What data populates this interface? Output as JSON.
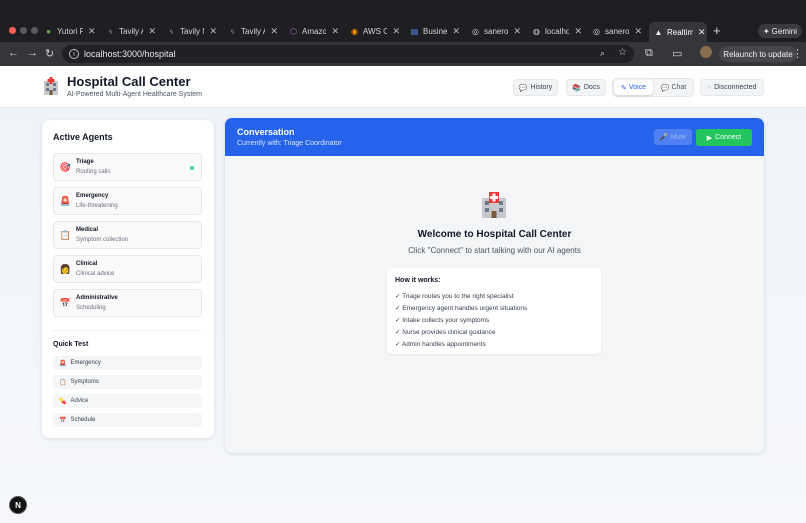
{
  "browser": {
    "tabs": [
      {
        "label": "Yutori Pl",
        "icon": "●"
      },
      {
        "label": "Tavily A",
        "icon": "ᛃ"
      },
      {
        "label": "Tavily M",
        "icon": "ᛃ"
      },
      {
        "label": "Tavily A",
        "icon": "ᛃ"
      },
      {
        "label": "Amazon",
        "icon": "⬡"
      },
      {
        "label": "AWS Co",
        "icon": "◉"
      },
      {
        "label": "Busines",
        "icon": "▤"
      },
      {
        "label": "saneroo",
        "icon": "◎"
      },
      {
        "label": "localho",
        "icon": "◍"
      },
      {
        "label": "saneroo",
        "icon": "◎"
      },
      {
        "label": "Realtim",
        "icon": "▲"
      }
    ],
    "close_glyph": "✕",
    "new_tab": "+",
    "gemini_label": "Gemini",
    "url": "localhost:3000/hospital",
    "relaunch_label": "Relaunch to update"
  },
  "app": {
    "title": "Hospital Call Center",
    "subtitle": "AI-Powered Multi-Agent Healthcare System",
    "buttons": {
      "history": "History",
      "docs": "Docs",
      "voice": "Voice",
      "chat": "Chat",
      "status": "Disconnected"
    }
  },
  "sidebar": {
    "title": "Active Agents",
    "agents": [
      {
        "name": "Triage",
        "desc": "Routing calls",
        "icon": "🎯",
        "active": true
      },
      {
        "name": "Emergency",
        "desc": "Life-threatening",
        "icon": "🚨",
        "active": false
      },
      {
        "name": "Medical",
        "desc": "Symptom collection",
        "icon": "📋",
        "active": false
      },
      {
        "name": "Clinical",
        "desc": "Clinical advice",
        "icon": "👩",
        "active": false
      },
      {
        "name": "Administrative",
        "desc": "Scheduling",
        "icon": "📅",
        "active": false
      }
    ],
    "quick_test_title": "Quick Test",
    "quick_tests": [
      {
        "label": "Emergency",
        "icon": "🚨"
      },
      {
        "label": "Symptoms",
        "icon": "📋"
      },
      {
        "label": "Advice",
        "icon": "💊"
      },
      {
        "label": "Schedule",
        "icon": "📅"
      }
    ]
  },
  "conversation": {
    "title": "Conversation",
    "current_agent": "Currently with: Triage Coordinator",
    "mute_label": "Mute",
    "connect_label": "Connect",
    "welcome_title": "Welcome to Hospital Call Center",
    "welcome_hint": "Click \"Connect\" to start talking with our AI agents",
    "how_title": "How it works:",
    "steps": [
      "✓ Triage routes you to the right specialist",
      "✓ Emergency agent handles urgent situations",
      "✓ Intake collects your symptoms",
      "✓ Nurse provides clinical guidance",
      "✓ Admin handles appointments"
    ]
  },
  "badge": "N"
}
